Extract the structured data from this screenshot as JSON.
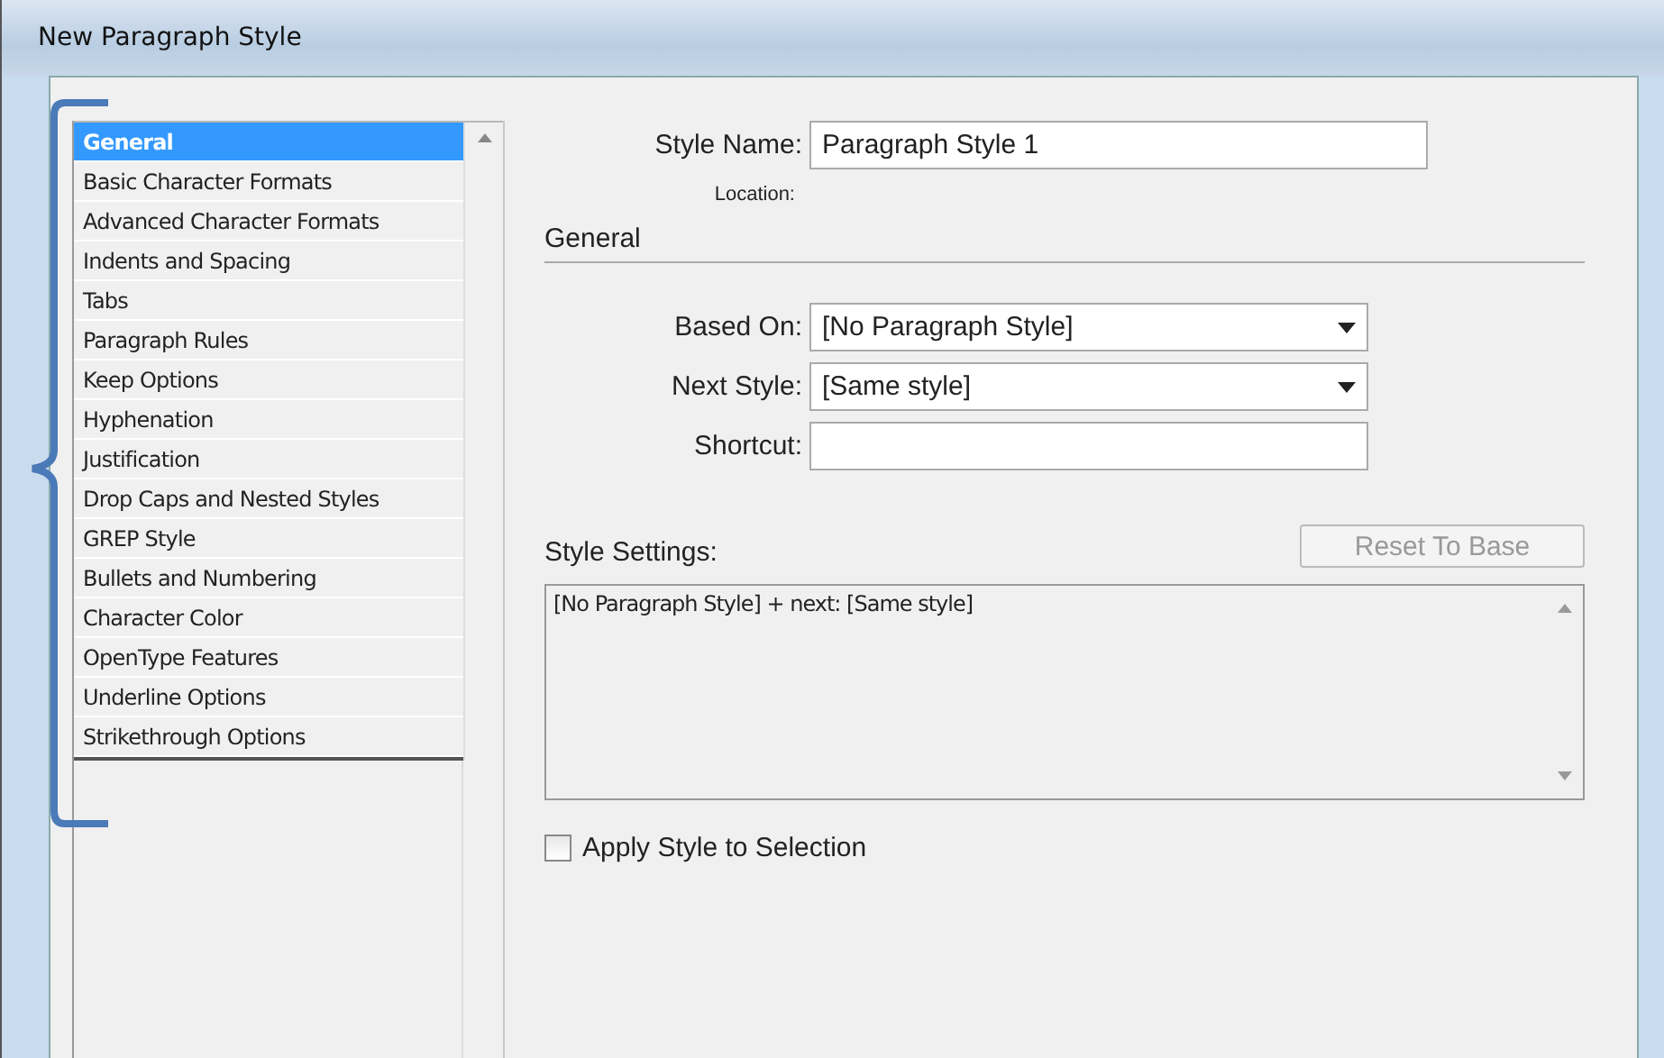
{
  "window": {
    "title": "New Paragraph Style"
  },
  "categories": [
    {
      "label": "General",
      "selected": true
    },
    {
      "label": "Basic Character Formats",
      "selected": false
    },
    {
      "label": "Advanced Character Formats",
      "selected": false
    },
    {
      "label": "Indents and Spacing",
      "selected": false
    },
    {
      "label": "Tabs",
      "selected": false
    },
    {
      "label": "Paragraph Rules",
      "selected": false
    },
    {
      "label": "Keep Options",
      "selected": false
    },
    {
      "label": "Hyphenation",
      "selected": false
    },
    {
      "label": "Justification",
      "selected": false
    },
    {
      "label": "Drop Caps and Nested Styles",
      "selected": false
    },
    {
      "label": "GREP Style",
      "selected": false
    },
    {
      "label": "Bullets and Numbering",
      "selected": false
    },
    {
      "label": "Character Color",
      "selected": false
    },
    {
      "label": "OpenType Features",
      "selected": false
    },
    {
      "label": "Underline Options",
      "selected": false
    },
    {
      "label": "Strikethrough Options",
      "selected": false
    }
  ],
  "style_name": {
    "label": "Style Name:",
    "value": "Paragraph Style 1"
  },
  "location": {
    "label": "Location:"
  },
  "section": {
    "title": "General"
  },
  "fields": [
    {
      "kind": "dropdown",
      "label": "Based On:",
      "value": "[No Paragraph Style]"
    },
    {
      "kind": "dropdown",
      "label": "Next Style:",
      "value": "[Same style]"
    },
    {
      "kind": "text",
      "label": "Shortcut:"
    }
  ],
  "style_settings": {
    "label": "Style Settings:",
    "text": "[No Paragraph Style] + next: [Same style]",
    "reset_button": {
      "label": "Reset To Base",
      "disabled": true
    }
  },
  "apply_to_selection": {
    "label": "Apply Style to Selection",
    "checked": false
  }
}
